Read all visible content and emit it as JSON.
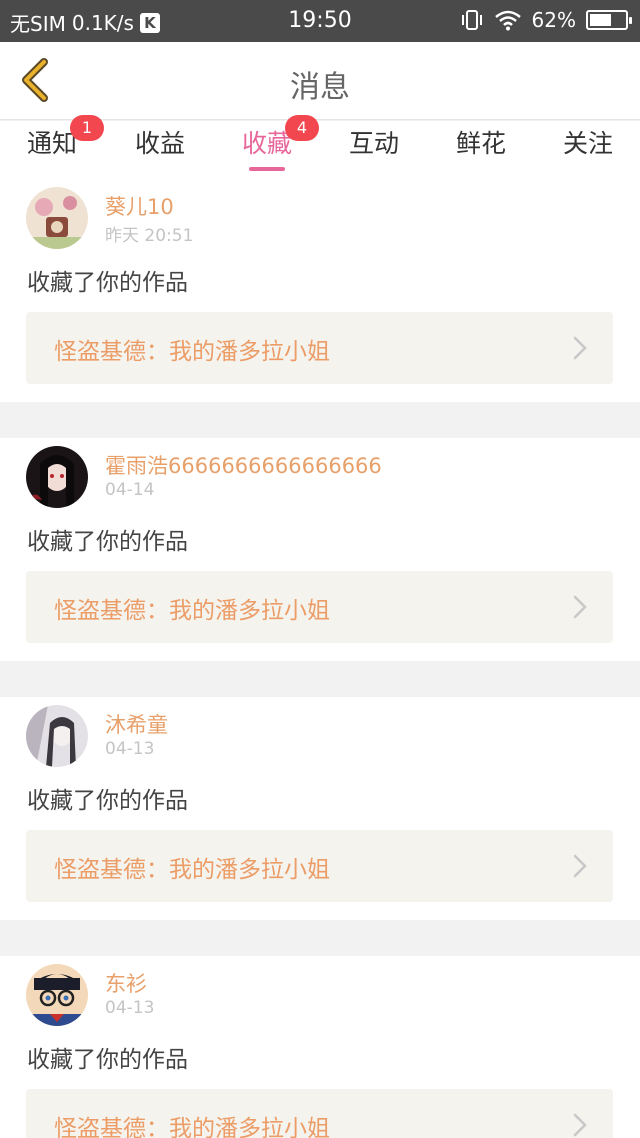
{
  "status_bar": {
    "carrier": "无SIM",
    "speed": "0.1K/s",
    "k_badge": "K",
    "time": "19:50",
    "battery_text": "62%",
    "battery_level": 0.62
  },
  "header": {
    "title": "消息"
  },
  "tabs": [
    {
      "label": "通知",
      "badge": "1"
    },
    {
      "label": "收益",
      "badge": ""
    },
    {
      "label": "收藏",
      "badge": "4"
    },
    {
      "label": "互动",
      "badge": ""
    },
    {
      "label": "鲜花",
      "badge": ""
    },
    {
      "label": "关注",
      "badge": ""
    }
  ],
  "active_tab": "收藏",
  "colors": {
    "accent": "#e8679b",
    "name": "#e8a06a",
    "work_title": "#ec9d67",
    "badge": "#f2474f",
    "back_arrow": "#e9b22a"
  },
  "items": [
    {
      "username": "葵儿10",
      "time": "昨天 20:51",
      "action": "收藏了你的作品",
      "work_title": "怪盗基德：我的潘多拉小姐"
    },
    {
      "username": "霍雨浩6666666666666666",
      "time": "04-14",
      "action": "收藏了你的作品",
      "work_title": "怪盗基德：我的潘多拉小姐"
    },
    {
      "username": "沐希童",
      "time": "04-13",
      "action": "收藏了你的作品",
      "work_title": "怪盗基德：我的潘多拉小姐"
    },
    {
      "username": "东衫",
      "time": "04-13",
      "action": "收藏了你的作品",
      "work_title": "怪盗基德：我的潘多拉小姐"
    }
  ]
}
